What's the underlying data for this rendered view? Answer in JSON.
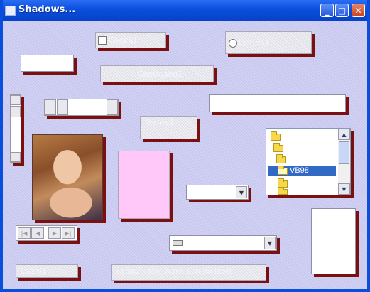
{
  "window": {
    "title": "Shadows...",
    "minimize_glyph": "_",
    "maximize_glyph": "□",
    "close_glyph": "✕"
  },
  "controls": {
    "checkbox_label": "Check1",
    "option_label": "Option1",
    "command_label": "Command1",
    "frame_label": "Frame1",
    "bottom_left_label": "Label1",
    "bottom_wide_label": "Label2 - Text in the bottom label"
  },
  "tree": {
    "items": [
      {
        "label": ""
      },
      {
        "label": ""
      },
      {
        "label": ""
      },
      {
        "label": "VB98",
        "selected": true
      },
      {
        "label": ""
      },
      {
        "label": ""
      }
    ]
  },
  "colors": {
    "client_bg": "#c8c8f0",
    "shadow": "#7a1010",
    "selection": "#316ac5",
    "pink_box": "#ffc8f8"
  }
}
